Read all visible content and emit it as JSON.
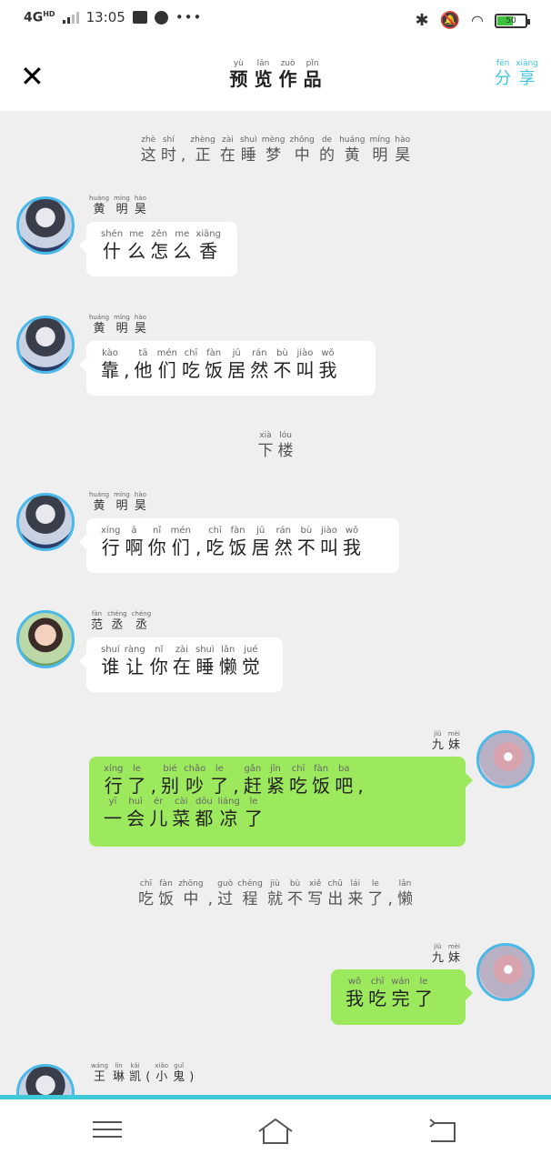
{
  "status": {
    "network": "4G",
    "network_sup": "HD",
    "time": "13:05",
    "battery": "50"
  },
  "header": {
    "title": [
      [
        "yù",
        "预"
      ],
      [
        "lǎn",
        "览"
      ],
      [
        "zuò",
        "作"
      ],
      [
        "pǐn",
        "品"
      ]
    ],
    "share": [
      [
        "fēn",
        "分"
      ],
      [
        "xiǎng",
        "享"
      ]
    ]
  },
  "narration_1": [
    [
      "zhè",
      "这"
    ],
    [
      "shí",
      "时"
    ],
    [
      "",
      ","
    ],
    [
      "zhèng",
      "正"
    ],
    [
      "zài",
      "在"
    ],
    [
      "shuì",
      "睡"
    ],
    [
      "mèng",
      "梦"
    ],
    [
      "zhōng",
      "中"
    ],
    [
      "de",
      "的"
    ],
    [
      "huáng",
      "黄"
    ],
    [
      "míng",
      "明"
    ],
    [
      "hào",
      "昊"
    ]
  ],
  "narration_2": [
    [
      "xià",
      "下"
    ],
    [
      "lóu",
      "楼"
    ]
  ],
  "narration_3": [
    [
      "chī",
      "吃"
    ],
    [
      "fàn",
      "饭"
    ],
    [
      "zhōng",
      "中"
    ],
    [
      "",
      ","
    ],
    [
      "guò",
      "过"
    ],
    [
      "chéng",
      "程"
    ],
    [
      "jiù",
      "就"
    ],
    [
      "bù",
      "不"
    ],
    [
      "xiě",
      "写"
    ],
    [
      "chū",
      "出"
    ],
    [
      "lái",
      "来"
    ],
    [
      "le",
      "了"
    ],
    [
      "",
      ","
    ],
    [
      "lǎn",
      "懒"
    ]
  ],
  "names": {
    "huang": [
      [
        "huáng",
        "黄"
      ],
      [
        "míng",
        "明"
      ],
      [
        "hào",
        "昊"
      ]
    ],
    "fan": [
      [
        "fàn",
        "范"
      ],
      [
        "chéng",
        "丞"
      ],
      [
        "chéng",
        "丞"
      ]
    ],
    "jiumei": [
      [
        "jiǔ",
        "九"
      ],
      [
        "mèi",
        "妹"
      ]
    ],
    "wang": [
      [
        "wáng",
        "王"
      ],
      [
        "lín",
        "琳"
      ],
      [
        "kǎi",
        "凯"
      ],
      [
        "",
        "("
      ],
      [
        "xiǎo",
        "小"
      ],
      [
        "guǐ",
        "鬼"
      ],
      [
        "",
        ")"
      ]
    ]
  },
  "messages": {
    "m1": [
      [
        [
          "shén",
          "什"
        ],
        [
          "me",
          "么"
        ],
        [
          "zěn",
          "怎"
        ],
        [
          "me",
          "么"
        ],
        [
          "xiāng",
          "香"
        ]
      ]
    ],
    "m2": [
      [
        [
          "kào",
          "靠"
        ],
        [
          "",
          ","
        ],
        [
          "tā",
          "他"
        ],
        [
          "mén",
          "们"
        ],
        [
          "chī",
          "吃"
        ],
        [
          "fàn",
          "饭"
        ],
        [
          "jū",
          "居"
        ],
        [
          "rán",
          "然"
        ],
        [
          "bù",
          "不"
        ],
        [
          "jiào",
          "叫"
        ],
        [
          "wǒ",
          "我"
        ]
      ]
    ],
    "m3": [
      [
        [
          "xíng",
          "行"
        ],
        [
          "ā",
          "啊"
        ],
        [
          "nǐ",
          "你"
        ],
        [
          "mén",
          "们"
        ],
        [
          "",
          ","
        ],
        [
          "chī",
          "吃"
        ],
        [
          "fàn",
          "饭"
        ],
        [
          "jū",
          "居"
        ],
        [
          "rán",
          "然"
        ],
        [
          "bù",
          "不"
        ],
        [
          "jiào",
          "叫"
        ],
        [
          "wǒ",
          "我"
        ]
      ]
    ],
    "m4": [
      [
        [
          "shuí",
          "谁"
        ],
        [
          "ràng",
          "让"
        ],
        [
          "nǐ",
          "你"
        ],
        [
          "zài",
          "在"
        ],
        [
          "shuì",
          "睡"
        ],
        [
          "lǎn",
          "懒"
        ],
        [
          "jué",
          "觉"
        ]
      ]
    ],
    "m5": [
      [
        [
          "xíng",
          "行"
        ],
        [
          "le",
          "了"
        ],
        [
          "",
          ","
        ],
        [
          "bié",
          "别"
        ],
        [
          "chǎo",
          "吵"
        ],
        [
          "le",
          "了"
        ],
        [
          "",
          ","
        ],
        [
          "gǎn",
          "赶"
        ],
        [
          "jǐn",
          "紧"
        ],
        [
          "chī",
          "吃"
        ],
        [
          "fàn",
          "饭"
        ],
        [
          "ba",
          "吧"
        ],
        [
          "",
          ","
        ]
      ],
      [
        [
          "yī",
          "一"
        ],
        [
          "huì",
          "会"
        ],
        [
          "ér",
          "儿"
        ],
        [
          "cài",
          "菜"
        ],
        [
          "dōu",
          "都"
        ],
        [
          "liáng",
          "凉"
        ],
        [
          "le",
          "了"
        ]
      ]
    ],
    "m6": [
      [
        [
          "wǒ",
          "我"
        ],
        [
          "chī",
          "吃"
        ],
        [
          "wán",
          "完"
        ],
        [
          "le",
          "了"
        ]
      ]
    ]
  }
}
